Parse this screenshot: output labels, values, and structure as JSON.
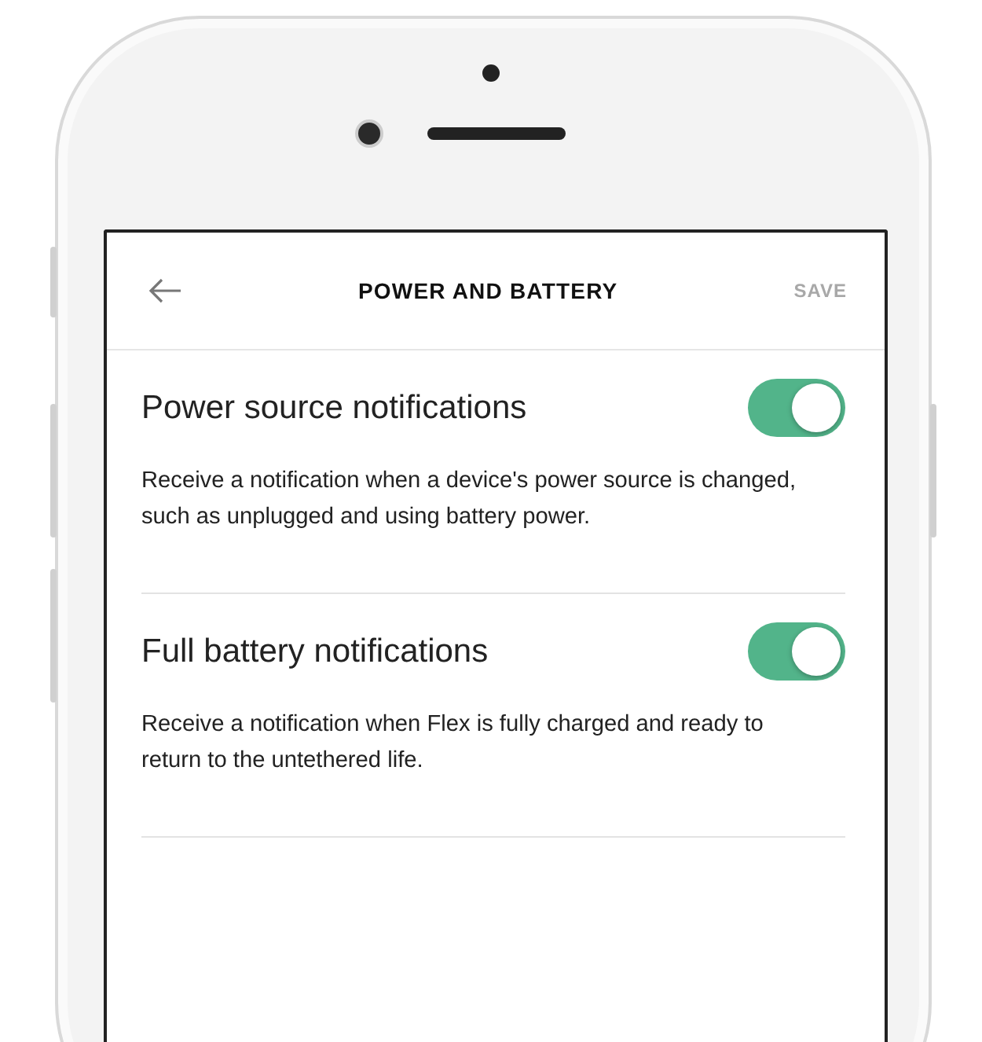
{
  "header": {
    "title": "POWER AND BATTERY",
    "save": {
      "label": "SAVE",
      "disabled": true
    }
  },
  "settings": [
    {
      "title": "Power source notifications",
      "on": true,
      "description": "Receive a notification when a device's power source is changed, such as unplugged and using battery power."
    },
    {
      "title": "Full battery notifications",
      "on": true,
      "description": "Receive a notification when Flex is fully charged and ready to return to the untethered life."
    }
  ]
}
